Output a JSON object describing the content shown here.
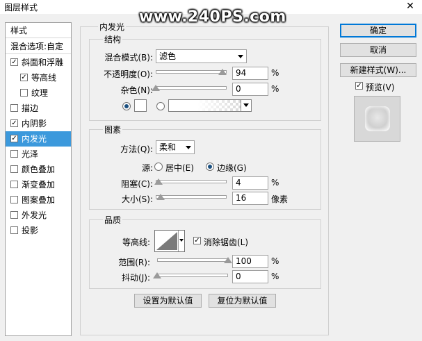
{
  "window": {
    "title": "图层样式",
    "watermark": "www.240PS.com",
    "close_glyph": "✕"
  },
  "styles_panel": {
    "header": "样式",
    "blending": "混合选项:自定",
    "items": [
      {
        "label": "斜面和浮雕",
        "checked": true,
        "indent": false
      },
      {
        "label": "等高线",
        "checked": true,
        "indent": true
      },
      {
        "label": "纹理",
        "checked": false,
        "indent": true
      },
      {
        "label": "描边",
        "checked": false,
        "indent": false
      },
      {
        "label": "内阴影",
        "checked": true,
        "indent": false
      },
      {
        "label": "内发光",
        "checked": true,
        "indent": false,
        "selected": true
      },
      {
        "label": "光泽",
        "checked": false,
        "indent": false
      },
      {
        "label": "颜色叠加",
        "checked": false,
        "indent": false
      },
      {
        "label": "渐变叠加",
        "checked": false,
        "indent": false
      },
      {
        "label": "图案叠加",
        "checked": false,
        "indent": false
      },
      {
        "label": "外发光",
        "checked": false,
        "indent": false
      },
      {
        "label": "投影",
        "checked": false,
        "indent": false
      }
    ]
  },
  "inner_glow": {
    "title": "内发光",
    "structure": {
      "title": "结构",
      "blend_mode_label": "混合模式(B):",
      "blend_mode_value": "滤色",
      "opacity_label": "不透明度(O):",
      "opacity_value": "94",
      "opacity_unit": "%",
      "opacity_fraction": 0.94,
      "noise_label": "杂色(N):",
      "noise_value": "0",
      "noise_unit": "%",
      "noise_fraction": 0.0,
      "color_swatch": "#ffffff"
    },
    "elements": {
      "title": "图素",
      "technique_label": "方法(Q):",
      "technique_value": "柔和",
      "source_label": "源:",
      "source_center": "居中(E)",
      "source_edge": "边缘(G)",
      "choke_label": "阻塞(C):",
      "choke_value": "4",
      "choke_unit": "%",
      "choke_fraction": 0.04,
      "size_label": "大小(S):",
      "size_value": "16",
      "size_unit": "像素",
      "size_fraction": 0.064
    },
    "quality": {
      "title": "品质",
      "contour_label": "等高线:",
      "antialias_label": "消除锯齿(L)",
      "range_label": "范围(R):",
      "range_value": "100",
      "range_unit": "%",
      "range_fraction": 1.0,
      "jitter_label": "抖动(J):",
      "jitter_value": "0",
      "jitter_unit": "%",
      "jitter_fraction": 0.0
    },
    "make_default": "设置为默认值",
    "reset_default": "复位为默认值"
  },
  "right": {
    "ok": "确定",
    "cancel": "取消",
    "new_style": "新建样式(W)...",
    "preview_label": "预览(V)"
  }
}
